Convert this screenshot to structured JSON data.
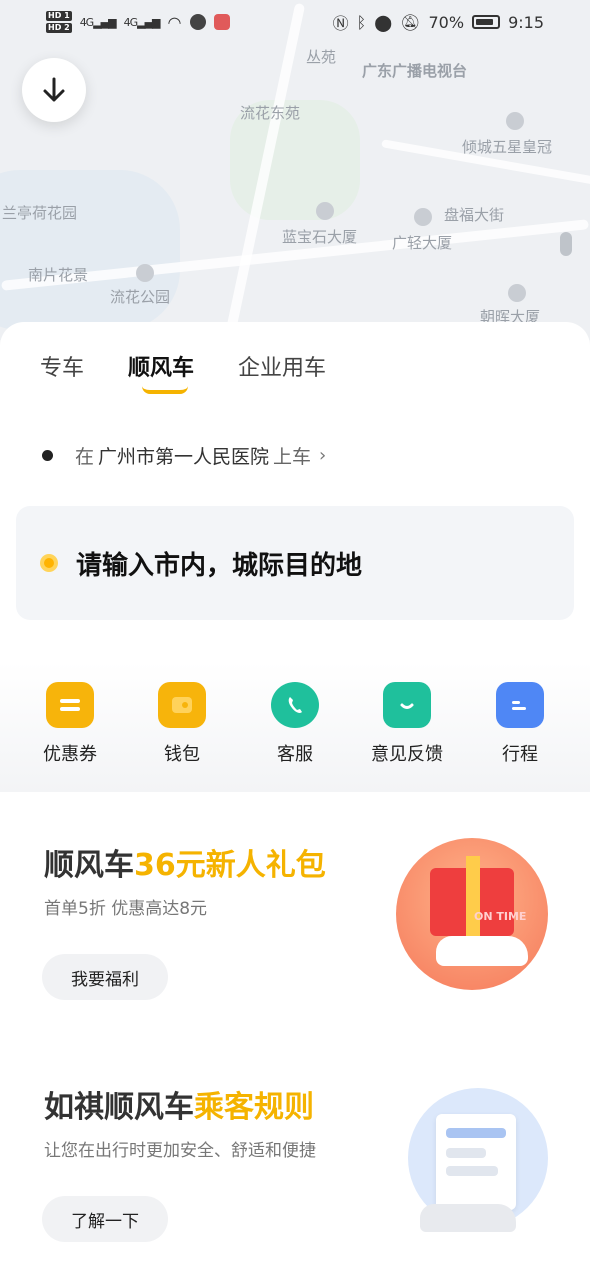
{
  "status_bar": {
    "hd1": "HD 1",
    "hd2": "HD 2",
    "net1": "4G",
    "net2": "4G",
    "battery": "70%",
    "time": "9:15"
  },
  "map": {
    "labels": [
      "丛苑",
      "广东广播电视台",
      "流花东苑",
      "倾城五星皇冠",
      "兰亭荷花园",
      "盘福大街",
      "蓝宝石大厦",
      "广轻大厦",
      "南片花景",
      "流花公园",
      "朝晖大厦"
    ]
  },
  "tabs": [
    "专车",
    "顺风车",
    "企业用车"
  ],
  "pickup": {
    "prefix": "在",
    "place": "广州市第一人民医院",
    "suffix": "上车"
  },
  "destination": {
    "placeholder": "请输入市内，城际目的地"
  },
  "quick_actions": [
    {
      "label": "优惠券",
      "icon": "coupon-icon",
      "color": "#f7b40b"
    },
    {
      "label": "钱包",
      "icon": "wallet-icon",
      "color": "#f7b40b"
    },
    {
      "label": "客服",
      "icon": "phone-icon",
      "color": "#1fc09c"
    },
    {
      "label": "意见反馈",
      "icon": "feedback-icon",
      "color": "#1fc09c"
    },
    {
      "label": "行程",
      "icon": "calendar-icon",
      "color": "#4f87f5"
    }
  ],
  "promo_card": {
    "title_main": "顺风车",
    "title_highlight": "36元新人礼包",
    "subtitle": "首单5折 优惠高达8元",
    "button": "我要福利",
    "badge_text": "ON TIME"
  },
  "rules_card": {
    "title_main": "如祺顺风车",
    "title_highlight": "乘客规则",
    "subtitle": "让您在出行时更加安全、舒适和便捷",
    "button": "了解一下"
  },
  "colors": {
    "accent": "#f5b300",
    "panel_bg": "#ffffff",
    "page_bg": "#f3f4f6"
  }
}
